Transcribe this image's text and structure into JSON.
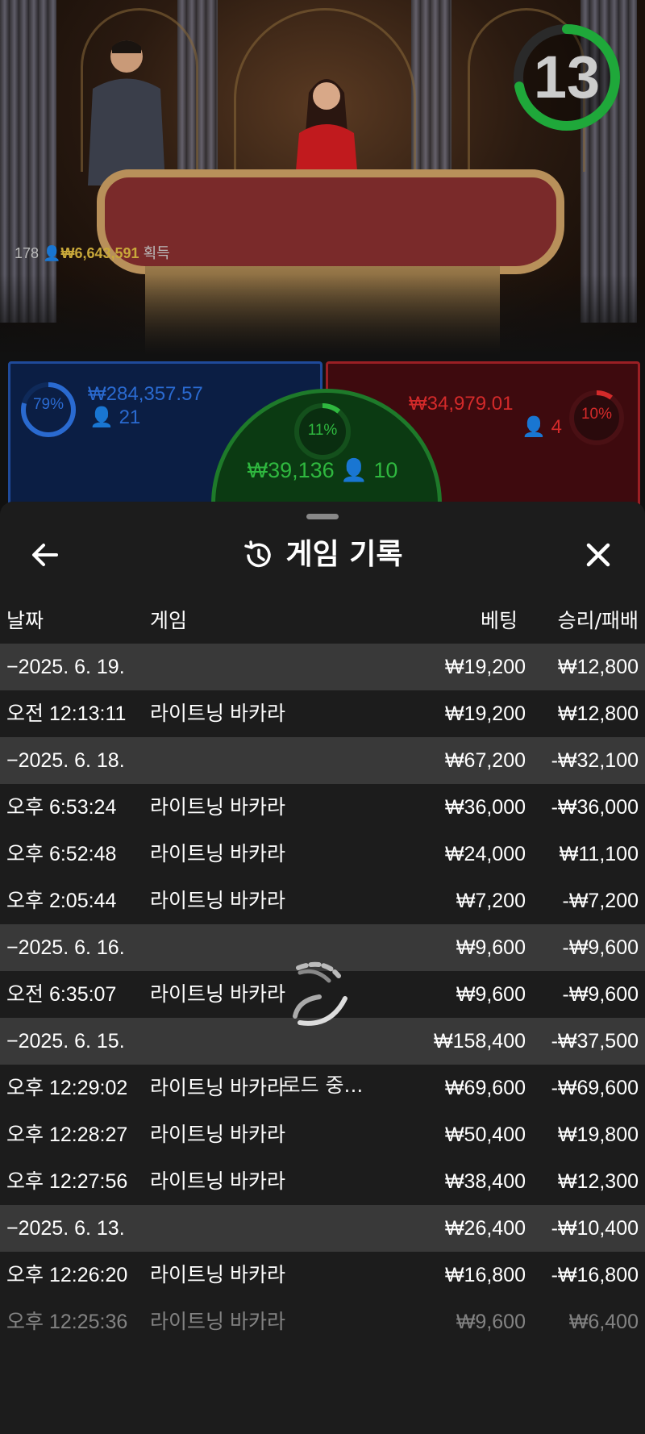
{
  "timer": {
    "seconds": "13",
    "progress": 0.72
  },
  "winners": {
    "count": "178",
    "amount": "₩6,643,591",
    "label": "획득"
  },
  "bets": {
    "player": {
      "percent": "79%",
      "amount": "₩284,357.57",
      "players": "21",
      "color": "#2a6ad0"
    },
    "tie": {
      "percent": "11%",
      "amount": "₩39,136",
      "players": "10",
      "color": "#2fb83f"
    },
    "banker": {
      "percent": "10%",
      "amount": "₩34,979.01",
      "players": "4",
      "color": "#d32a2a"
    }
  },
  "sheet": {
    "title": "게임 기록",
    "back_icon": "back-arrow-icon",
    "close_icon": "close-icon",
    "history_icon": "history-icon",
    "columns": {
      "date": "날짜",
      "game": "게임",
      "bet": "베팅",
      "result": "승리/패배"
    },
    "loading_text": "로드 중..."
  },
  "history": [
    {
      "type": "group",
      "date": "−2025. 6. 19.",
      "bet": "₩19,200",
      "result": "₩12,800"
    },
    {
      "type": "item",
      "time": "오전 12:13:11",
      "game": "라이트닝 바카라",
      "bet": "₩19,200",
      "result": "₩12,800"
    },
    {
      "type": "group",
      "date": "−2025. 6. 18.",
      "bet": "₩67,200",
      "result": "-₩32,100"
    },
    {
      "type": "item",
      "time": "오후 6:53:24",
      "game": "라이트닝 바카라",
      "bet": "₩36,000",
      "result": "-₩36,000"
    },
    {
      "type": "item",
      "time": "오후 6:52:48",
      "game": "라이트닝 바카라",
      "bet": "₩24,000",
      "result": "₩11,100"
    },
    {
      "type": "item",
      "time": "오후 2:05:44",
      "game": "라이트닝 바카라",
      "bet": "₩7,200",
      "result": "-₩7,200"
    },
    {
      "type": "group",
      "date": "−2025. 6. 16.",
      "bet": "₩9,600",
      "result": "-₩9,600"
    },
    {
      "type": "item",
      "time": "오전 6:35:07",
      "game": "라이트닝 바카라",
      "bet": "₩9,600",
      "result": "-₩9,600"
    },
    {
      "type": "group",
      "date": "−2025. 6. 15.",
      "bet": "₩158,400",
      "result": "-₩37,500"
    },
    {
      "type": "item",
      "time": "오후 12:29:02",
      "game": "라이트닝 바카라",
      "bet": "₩69,600",
      "result": "-₩69,600"
    },
    {
      "type": "item",
      "time": "오후 12:28:27",
      "game": "라이트닝 바카라",
      "bet": "₩50,400",
      "result": "₩19,800"
    },
    {
      "type": "item",
      "time": "오후 12:27:56",
      "game": "라이트닝 바카라",
      "bet": "₩38,400",
      "result": "₩12,300"
    },
    {
      "type": "group",
      "date": "−2025. 6. 13.",
      "bet": "₩26,400",
      "result": "-₩10,400"
    },
    {
      "type": "item",
      "time": "오후 12:26:20",
      "game": "라이트닝 바카라",
      "bet": "₩16,800",
      "result": "-₩16,800"
    },
    {
      "type": "item",
      "time": "오후 12:25:36",
      "game": "라이트닝 바카라",
      "bet": "₩9,600",
      "result": "₩6,400"
    }
  ]
}
